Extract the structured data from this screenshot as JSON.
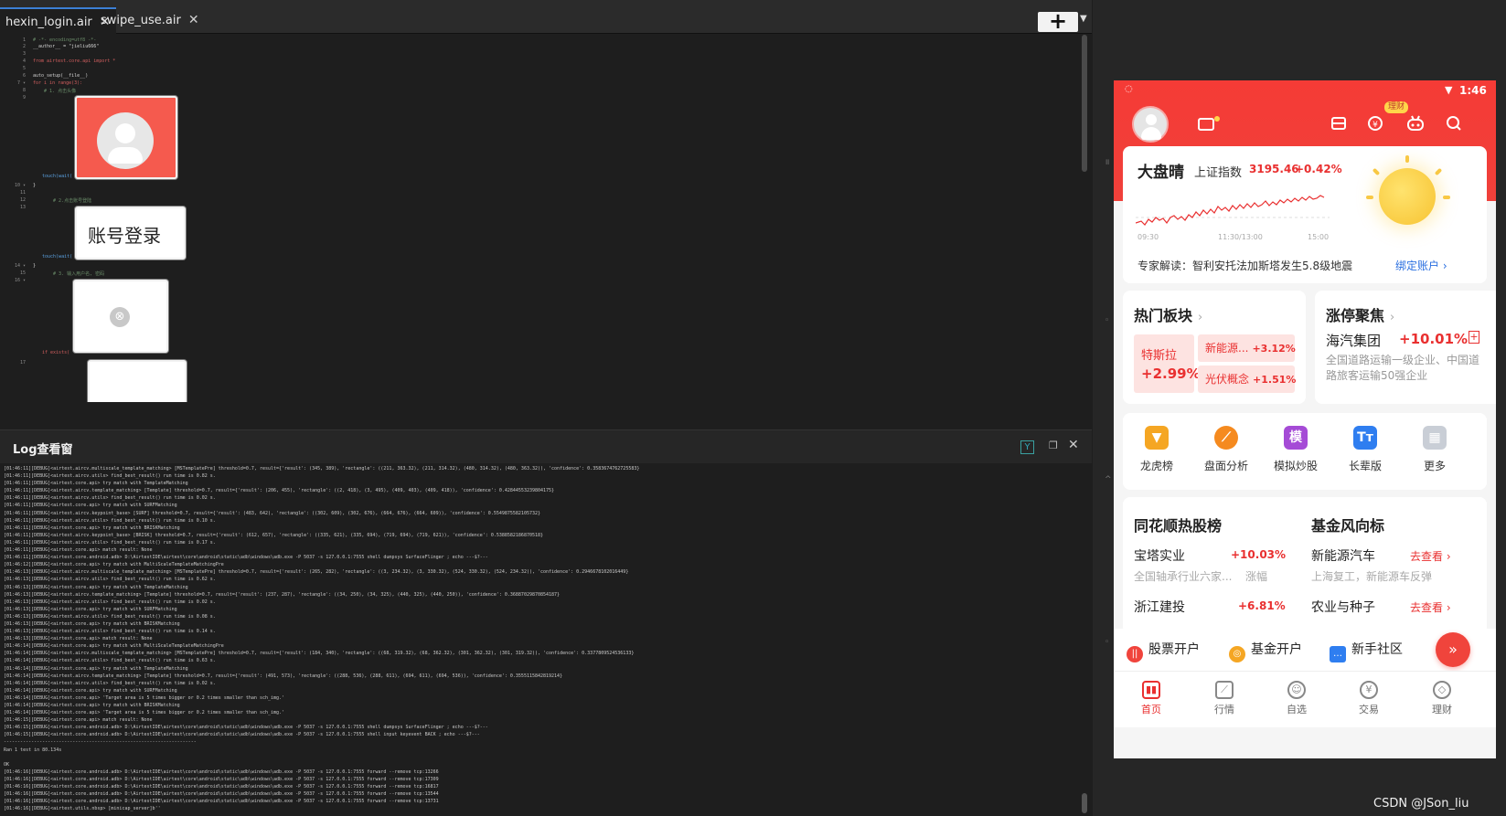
{
  "ide": {
    "tabs": [
      {
        "label": "hexin_login.air",
        "close": "✕"
      },
      {
        "label": "swipe_use.air",
        "close": "✕"
      }
    ],
    "add_button": "+",
    "add_dropdown": "▼",
    "code": {
      "line_numbers": [
        "1",
        "2",
        "3",
        "4",
        "5",
        "6",
        "7 ▾",
        "8",
        "9",
        "10 ▾",
        "11",
        "12",
        "13",
        "14 ▾",
        "15",
        "16 ▾",
        "17"
      ],
      "lines": [
        "# -*- encoding=utf8 -*-",
        "__author__ = \"jieliu666\"",
        "from airtest.core.api import *",
        "auto_setup(__file__)",
        "for i in range(3):",
        "    # 1. 点击头像",
        "touch(wait(",
        "}",
        "    # 2.点击账号登陆",
        "touch(wait(",
        "}",
        "    # 3. 输入用户名, 密码",
        "if exists("
      ],
      "template_images": [
        {
          "caption": "avatar-placeholder"
        },
        {
          "caption": "账号登录"
        },
        {
          "caption": "⊗"
        },
        {
          "caption": ""
        }
      ]
    }
  },
  "log": {
    "title": "Log查看窗",
    "filter_icon": "Y",
    "restore_icon": "❐",
    "close_icon": "✕",
    "lines": [
      "[01:46:11][DEBUG]<airtest.aircv.multiscale_template_matching> [MSTemplatePre] threshold=0.7, result={'result': (345, 389), 'rectangle': ((211, 363.32), (211, 314.32), (480, 314.32), (480, 363.32)), 'confidence': 0.3583674762725583}",
      "[01:46:11][DEBUG]<airtest.aircv.utils> find_best_result() run time is 0.82 s.",
      "[01:46:11][DEBUG]<airtest.core.api> try match with TemplateMatching",
      "[01:46:11][DEBUG]<airtest.aircv.template_matching> [Template] threshold=0.7, result={'result': (206, 455), 'rectangle': ((2, 418), (3, 495), (409, 403), (409, 418)), 'confidence': 0.42844553239804175}",
      "[01:46:11][DEBUG]<airtest.aircv.utils> find_best_result() run time is 0.02 s.",
      "[01:46:11][DEBUG]<airtest.core.api> try match with SURFMatching",
      "[01:46:11][DEBUG]<airtest.aircv.keypoint_base> [SURF] threshold=0.7, result={'result': (483, 642), 'rectangle': ((302, 609), (302, 676), (664, 676), (664, 609)), 'confidence': 0.5549875582105732}",
      "[01:46:11][DEBUG]<airtest.aircv.utils> find_best_result() run time is 0.10 s.",
      "[01:46:11][DEBUG]<airtest.core.api> try match with BRISKMatching",
      "[01:46:11][DEBUG]<airtest.aircv.keypoint_base> [BRISK] threshold=0.7, result={'result': (612, 657), 'rectangle': ((335, 621), (335, 694), (719, 694), (719, 621)), 'confidence': 0.5388582186870518}",
      "[01:46:11][DEBUG]<airtest.aircv.utils> find_best_result() run time is 0.17 s.",
      "[01:46:11][DEBUG]<airtest.core.api> match result: None",
      "[01:46:11][DEBUG]<airtest.core.android.adb> D:\\AirtestIDE\\airtest\\core\\android\\static\\adb\\windows\\adb.exe -P 5037 -s 127.0.0.1:7555 shell dumpsys SurfaceFlinger ; echo ---$?---",
      "[01:46:12][DEBUG]<airtest.core.api> try match with MultiScaleTemplateMatchingPre",
      "[01:46:13][DEBUG]<airtest.aircv.multiscale_template_matching> [MSTemplatePre] threshold=0.7, result={'result': (265, 282), 'rectangle': ((3, 234.32), (3, 330.32), (524, 330.32), (524, 234.32)), 'confidence': 0.2946678102016449}",
      "[01:46:13][DEBUG]<airtest.aircv.utils> find_best_result() run time is 0.62 s.",
      "[01:46:13][DEBUG]<airtest.core.api> try match with TemplateMatching",
      "[01:46:13][DEBUG]<airtest.aircv.template_matching> [Template] threshold=0.7, result={'result': (237, 287), 'rectangle': ((34, 250), (34, 325), (440, 325), (440, 250)), 'confidence': 0.36887029870854187}",
      "[01:46:13][DEBUG]<airtest.aircv.utils> find_best_result() run time is 0.02 s.",
      "[01:46:13][DEBUG]<airtest.core.api> try match with SURFMatching",
      "[01:46:13][DEBUG]<airtest.aircv.utils> find_best_result() run time is 0.08 s.",
      "[01:46:13][DEBUG]<airtest.core.api> try match with BRISKMatching",
      "[01:46:13][DEBUG]<airtest.aircv.utils> find_best_result() run time is 0.14 s.",
      "[01:46:13][DEBUG]<airtest.core.api> match result: None",
      "[01:46:14][DEBUG]<airtest.core.api> try match with MultiScaleTemplateMatchingPre",
      "[01:46:14][DEBUG]<airtest.aircv.multiscale_template_matching> [MSTemplatePre] threshold=0.7, result={'result': (184, 340), 'rectangle': ((68, 319.32), (68, 362.32), (301, 362.32), (301, 319.32)), 'confidence': 0.3377809524536133}",
      "[01:46:14][DEBUG]<airtest.aircv.utils> find_best_result() run time is 0.63 s.",
      "[01:46:14][DEBUG]<airtest.core.api> try match with TemplateMatching",
      "[01:46:14][DEBUG]<airtest.aircv.template_matching> [Template] threshold=0.7, result={'result': (491, 573), 'rectangle': ((288, 536), (288, 611), (694, 611), (694, 536)), 'confidence': 0.3555115842819214}",
      "[01:46:14][DEBUG]<airtest.aircv.utils> find_best_result() run time is 0.02 s.",
      "[01:46:14][DEBUG]<airtest.core.api> try match with SURFMatching",
      "[01:46:14][DEBUG]<airtest.core.api> 'Target area is 5 times bigger or 0.2 times smaller than sch_img.'",
      "[01:46:14][DEBUG]<airtest.core.api> try match with BRISKMatching",
      "[01:46:14][DEBUG]<airtest.core.api> 'Target area is 5 times bigger or 0.2 times smaller than sch_img.'",
      "[01:46:15][DEBUG]<airtest.core.api> match result: None",
      "[01:46:15][DEBUG]<airtest.core.android.adb> D:\\AirtestIDE\\airtest\\core\\android\\static\\adb\\windows\\adb.exe -P 5037 -s 127.0.0.1:7555 shell dumpsys SurfaceFlinger ; echo ---$?---",
      "[01:46:15][DEBUG]<airtest.core.android.adb> D:\\AirtestIDE\\airtest\\core\\android\\static\\adb\\windows\\adb.exe -P 5037 -s 127.0.0.1:7555 shell input keyevent BACK ; echo ---$?---",
      "----------------------------------------------------------------------",
      "Ran 1 test in 80.134s",
      "",
      "OK",
      "[01:46:16][DEBUG]<airtest.core.android.adb> D:\\AirtestIDE\\airtest\\core\\android\\static\\adb\\windows\\adb.exe -P 5037 -s 127.0.0.1:7555 forward --remove tcp:13266",
      "[01:46:16][DEBUG]<airtest.core.android.adb> D:\\AirtestIDE\\airtest\\core\\android\\static\\adb\\windows\\adb.exe -P 5037 -s 127.0.0.1:7555 forward --remove tcp:17309",
      "[01:46:16][DEBUG]<airtest.core.android.adb> D:\\AirtestIDE\\airtest\\core\\android\\static\\adb\\windows\\adb.exe -P 5037 -s 127.0.0.1:7555 forward --remove tcp:16817",
      "[01:46:16][DEBUG]<airtest.core.android.adb> D:\\AirtestIDE\\airtest\\core\\android\\static\\adb\\windows\\adb.exe -P 5037 -s 127.0.0.1:7555 forward --remove tcp:13544",
      "[01:46:16][DEBUG]<airtest.core.android.adb> D:\\AirtestIDE\\airtest\\core\\android\\static\\adb\\windows\\adb.exe -P 5037 -s 127.0.0.1:7555 forward --remove tcp:13731",
      "[01:46:16][DEBUG]<airtest.utils.nbsp> [minicap_server]b''",
      "[01:46:16][DEBUG]<airtest.utils.nbsp> [minitouch_server]b''",
      "[Finished]",
      "",
      "======================================================================"
    ]
  },
  "phone": {
    "status": {
      "left_icon": "◌",
      "wifi": "▼",
      "time": "1:46"
    },
    "header": {
      "finance_badge": "理财"
    },
    "market": {
      "title": "大盘晴",
      "index_name": "上证指数",
      "index_value": "3195.46",
      "index_change": "+0.42%",
      "chart_ticks": [
        "09:30",
        "11:30/13:00",
        "15:00"
      ],
      "expert_text": "专家解读：智利安托法加斯塔发生5.8级地震",
      "bind_link": "绑定账户 ›"
    },
    "hot_sectors": {
      "title": "热门板块",
      "chevron": "›",
      "main": {
        "name": "特斯拉",
        "change": "+2.99%"
      },
      "others": [
        {
          "name": "新能源...",
          "change": "+3.12%"
        },
        {
          "name": "光伏概念",
          "change": "+1.51%"
        }
      ]
    },
    "limit_up": {
      "title": "涨停聚焦",
      "chevron": "›",
      "stock": "海汽集团",
      "change": "+10.01%",
      "plus": "+",
      "desc": "全国道路运输一级企业、中国道路旅客运输50强企业"
    },
    "quick_menu": [
      {
        "label": "龙虎榜",
        "glyph": "▼",
        "color": "#f5a623"
      },
      {
        "label": "盘面分析",
        "glyph": "⟋",
        "color": "#f58a1f"
      },
      {
        "label": "模拟炒股",
        "glyph": "模",
        "color": "#a54bd6"
      },
      {
        "label": "长辈版",
        "glyph": "Tт",
        "color": "#2f7ef0"
      },
      {
        "label": "更多",
        "glyph": "▦",
        "color": "#c9ced6"
      }
    ],
    "rank_hot": {
      "title": "同花顺热股榜",
      "items": [
        {
          "name": "宝塔实业",
          "change": "+10.03%",
          "sub": "全国轴承行业六家...",
          "tag": "涨幅"
        },
        {
          "name": "浙江建投",
          "change": "+6.81%"
        }
      ]
    },
    "rank_fund": {
      "title": "基金风向标",
      "items": [
        {
          "name": "新能源汽车",
          "link": "去查看 ›",
          "sub": "上海复工，新能源车反弹"
        },
        {
          "name": "农业与种子",
          "link": "去查看 ›"
        }
      ]
    },
    "bottom_strip": [
      {
        "label": "股票开户",
        "icon": "stock-open-icon",
        "glyph": "||",
        "color": "#f0443c"
      },
      {
        "label": "基金开户",
        "icon": "fund-open-icon",
        "glyph": "◎",
        "color": "#f5a623"
      },
      {
        "label": "新手社区",
        "icon": "community-icon",
        "glyph": "…",
        "color": "#2f7ef0"
      }
    ],
    "fab": "»",
    "nav": [
      {
        "label": "首页",
        "glyph": "▮▮",
        "active": true
      },
      {
        "label": "行情",
        "glyph": "⟋"
      },
      {
        "label": "自选",
        "glyph": "☺"
      },
      {
        "label": "交易",
        "glyph": "¥"
      },
      {
        "label": "理财",
        "glyph": "◇"
      }
    ]
  },
  "watermark": "CSDN @JSon_liu",
  "colors": {
    "accent_red": "#f0403a",
    "link_blue": "#2a6fe0",
    "ide_bg": "#1e1e1e"
  }
}
